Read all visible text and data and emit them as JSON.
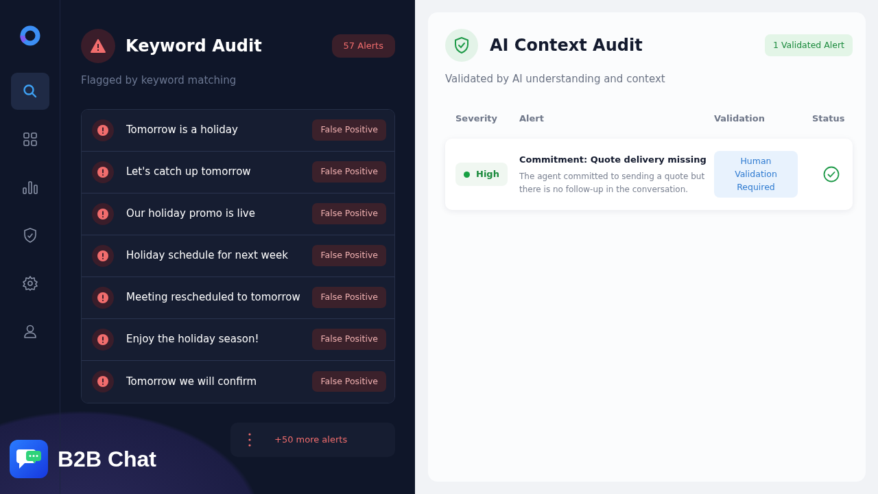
{
  "sidebar": {
    "items": [
      {
        "kind": "search",
        "selected": true
      },
      {
        "kind": "grid",
        "selected": false
      },
      {
        "kind": "chart",
        "selected": false
      },
      {
        "kind": "shield",
        "selected": false
      },
      {
        "kind": "gear",
        "selected": false
      },
      {
        "kind": "user",
        "selected": false
      }
    ]
  },
  "brand": {
    "name": "B2B Chat"
  },
  "keyword_audit": {
    "title": "Keyword Audit",
    "count_badge": "57 Alerts",
    "subtitle": "Flagged by keyword matching",
    "alerts": [
      {
        "text": "Tomorrow is a holiday",
        "tag": "False Positive"
      },
      {
        "text": "Let's catch up tomorrow",
        "tag": "False Positive"
      },
      {
        "text": "Our holiday promo is live",
        "tag": "False Positive"
      },
      {
        "text": "Holiday schedule for next week",
        "tag": "False Positive"
      },
      {
        "text": "Meeting rescheduled to tomorrow",
        "tag": "False Positive"
      },
      {
        "text": "Enjoy the holiday season!",
        "tag": "False Positive"
      },
      {
        "text": "Tomorrow we will confirm",
        "tag": "False Positive"
      }
    ],
    "more": "+50 more alerts"
  },
  "ai_audit": {
    "title": "AI Context Audit",
    "count_badge": "1 Validated Alert",
    "subtitle": "Validated by AI understanding and context",
    "table": {
      "columns": [
        "Severity",
        "Alert",
        "Validation",
        "Status"
      ],
      "rows": [
        {
          "severity": "High",
          "title": "Commitment: Quote delivery missing",
          "description": "The agent committed to sending a quote but there is no follow-up in the conversation.",
          "validation": "Human Validation Required",
          "validated": true
        }
      ]
    }
  }
}
